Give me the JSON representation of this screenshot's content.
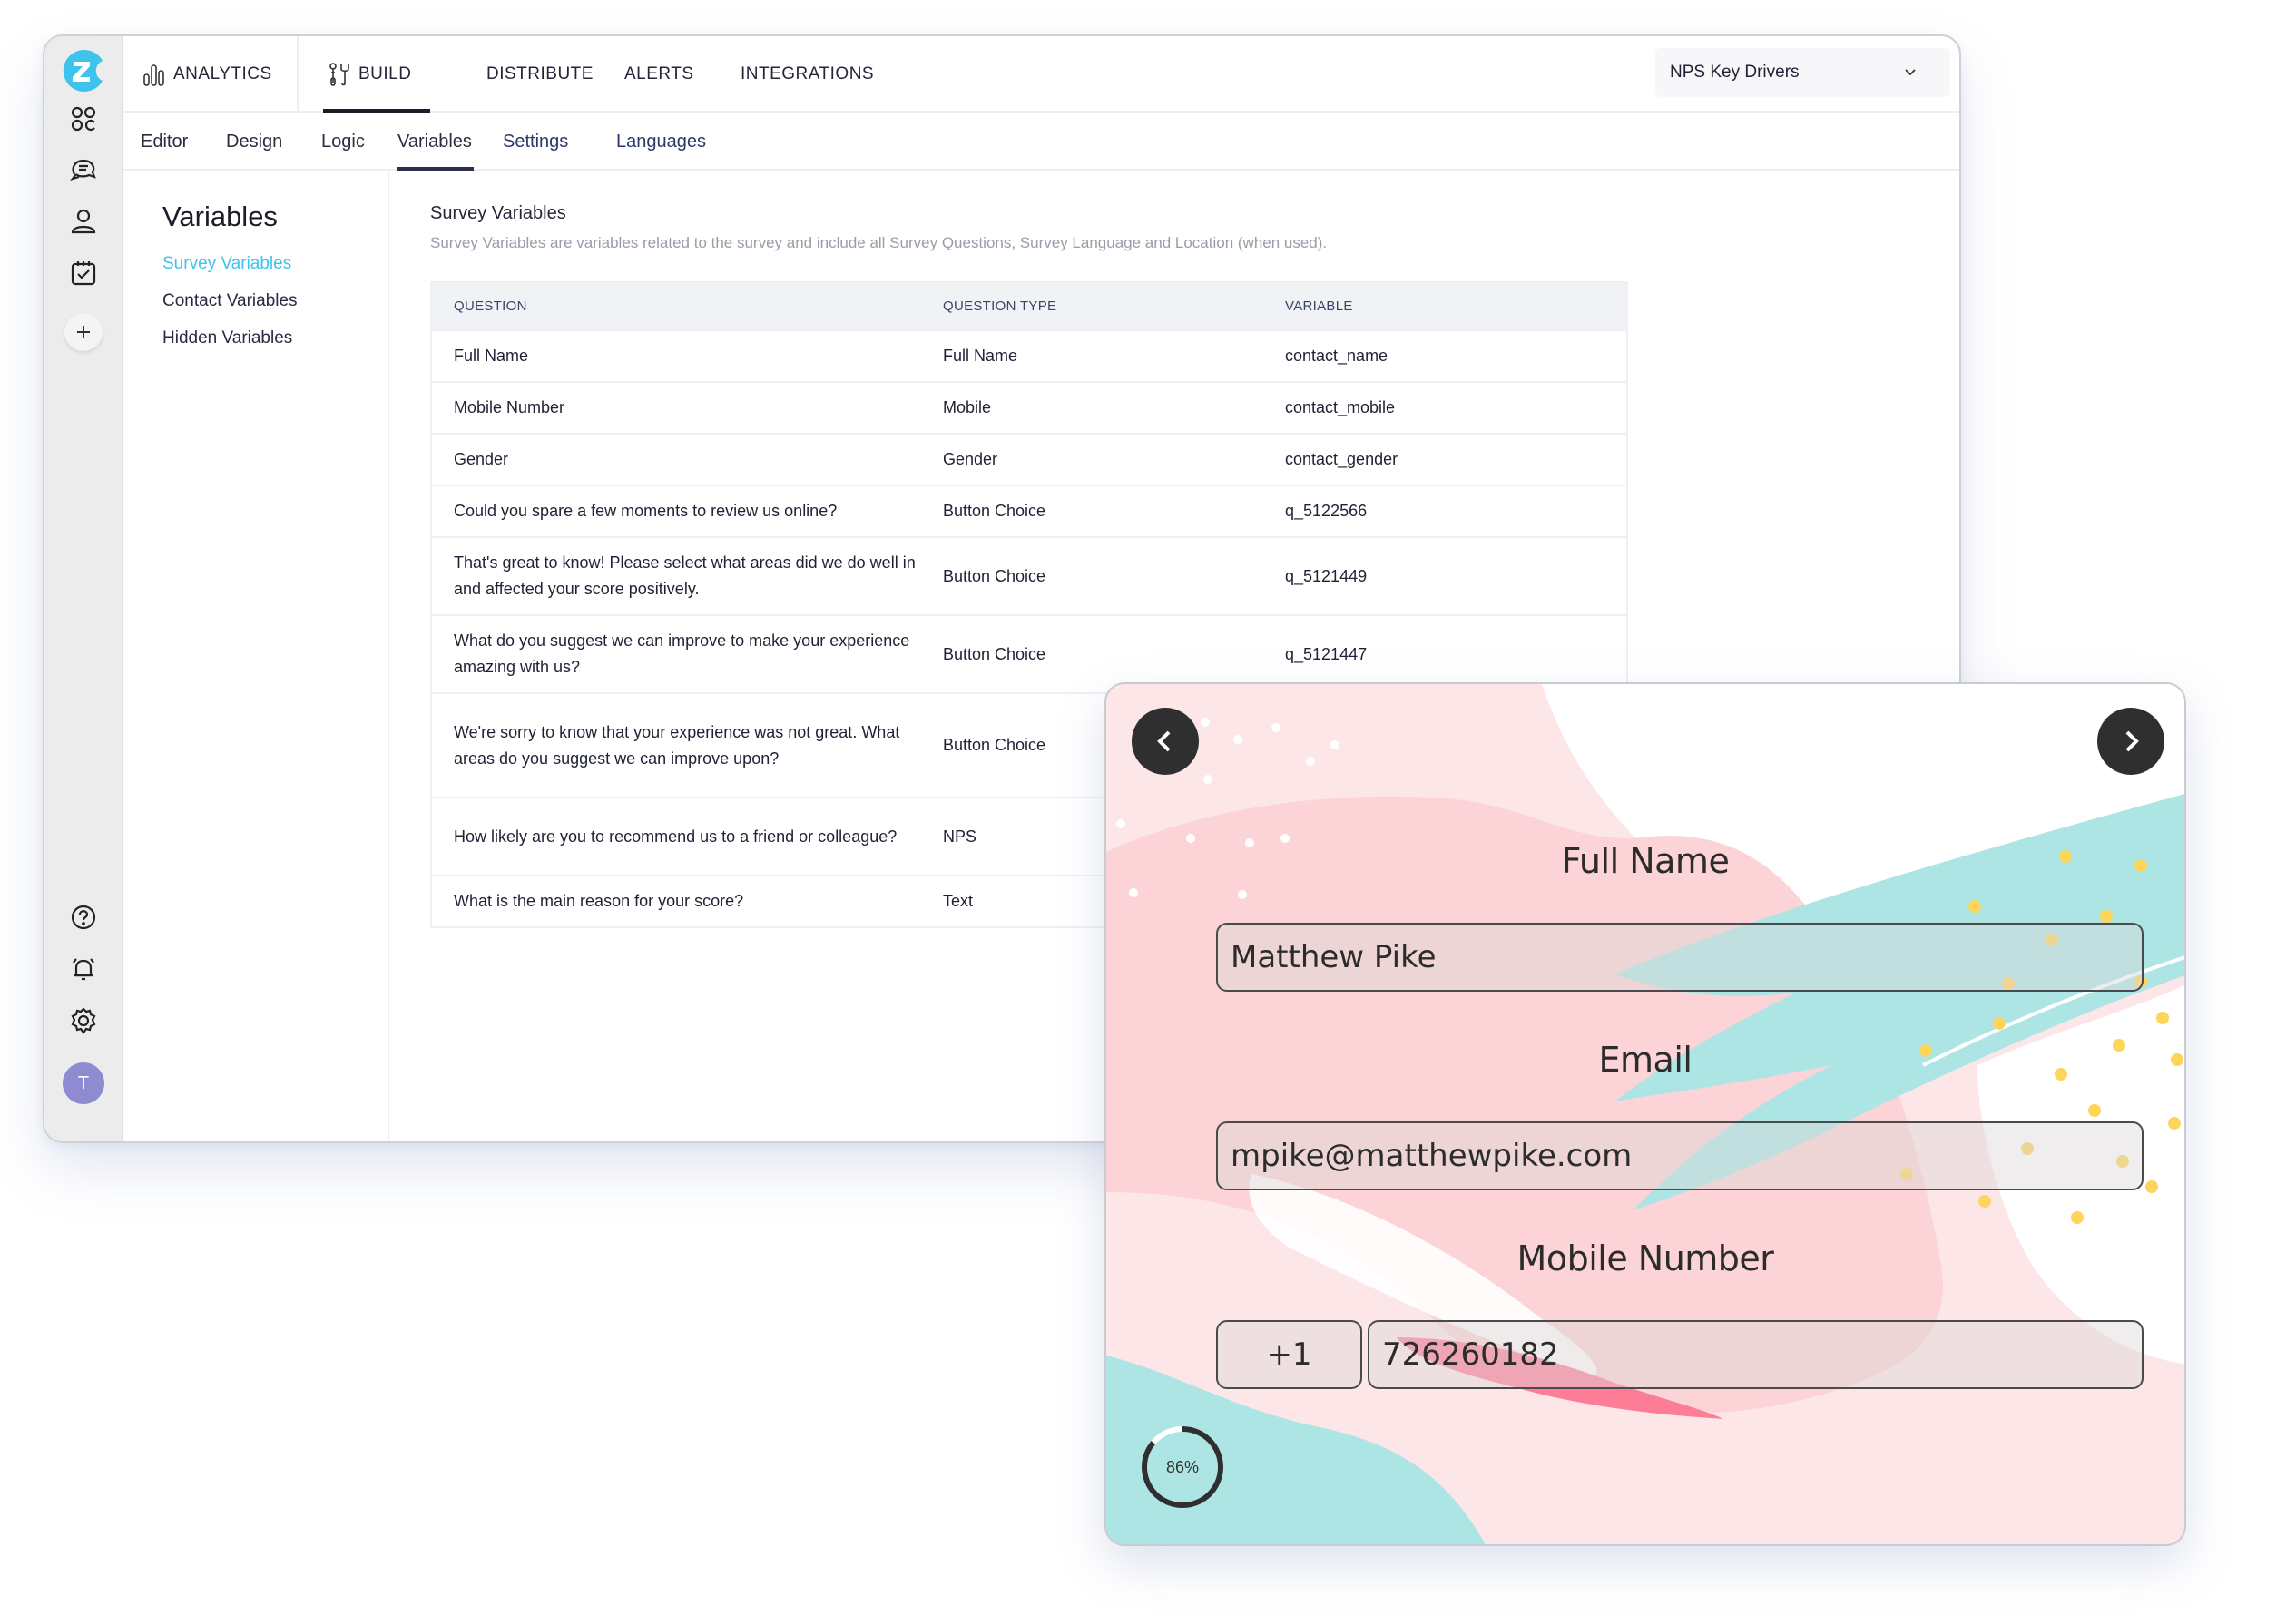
{
  "app": {
    "brand_color": "#3ec3ec",
    "rail": {
      "logo": "zonka-logo",
      "top_icons": [
        "dashboard-icon",
        "chat-icon",
        "user-icon",
        "calendar-check-icon",
        "plus-icon"
      ],
      "bottom_icons": [
        "help-icon",
        "bell-icon",
        "gear-icon"
      ],
      "avatar_initial": "T",
      "avatar_color": "#8f8bd0"
    },
    "topnav": {
      "items": [
        {
          "label": "ANALYTICS",
          "icon": "bar-chart-icon"
        },
        {
          "label": "BUILD",
          "icon": "tools-icon",
          "active": true
        },
        {
          "label": "DISTRIBUTE"
        },
        {
          "label": "ALERTS"
        },
        {
          "label": "INTEGRATIONS"
        }
      ],
      "survey_select": "NPS Key Drivers"
    },
    "subnav": {
      "items": [
        "Editor",
        "Design",
        "Logic",
        "Variables",
        "Settings",
        "Languages"
      ],
      "active": "Variables"
    },
    "left_panel": {
      "title": "Variables",
      "links": [
        "Survey Variables",
        "Contact Variables",
        "Hidden Variables"
      ],
      "active": "Survey Variables"
    },
    "content": {
      "title": "Survey Variables",
      "description": "Survey Variables are variables related to the survey and include all Survey Questions, Survey Language and Location (when used).",
      "table": {
        "headers": [
          "QUESTION",
          "QUESTION TYPE",
          "VARIABLE"
        ],
        "rows": [
          {
            "question": "Full Name",
            "type": "Full Name",
            "variable": "contact_name"
          },
          {
            "question": "Mobile Number",
            "type": "Mobile",
            "variable": "contact_mobile"
          },
          {
            "question": "Gender",
            "type": "Gender",
            "variable": "contact_gender"
          },
          {
            "question": "Could you spare a few moments to review us online?",
            "type": "Button Choice",
            "variable": "q_5122566"
          },
          {
            "question": "That's great to know! Please select what areas did we do well in and affected your score positively.",
            "type": "Button Choice",
            "variable": "q_5121449"
          },
          {
            "question": "What do you suggest we can improve to make your experience amazing with us?",
            "type": "Button Choice",
            "variable": "q_5121447"
          },
          {
            "question": "We're sorry to know that your experience was not great. What areas do you suggest we can improve upon?",
            "type": "Button Choice",
            "variable": ""
          },
          {
            "question": "How likely are you to recommend us to a friend or colleague?",
            "type": "NPS",
            "variable": ""
          },
          {
            "question": "What is the main reason for your score?",
            "type": "Text",
            "variable": ""
          }
        ]
      }
    }
  },
  "survey_preview": {
    "fields": [
      {
        "label": "Full Name",
        "value": "Matthew Pike"
      },
      {
        "label": "Email",
        "value": "mpike@matthewpike.com"
      },
      {
        "label": "Mobile Number",
        "country_code": "+1",
        "value": "726260182"
      }
    ],
    "progress_percent": 86,
    "progress_label": "86%",
    "colors": {
      "pink": "#fcd3d6",
      "light_pink": "#fde6e7",
      "teal": "#ade5e5",
      "yellow": "#fdd55a",
      "hot_pink": "#fd7d97",
      "nav": "#2f2f2f"
    }
  }
}
